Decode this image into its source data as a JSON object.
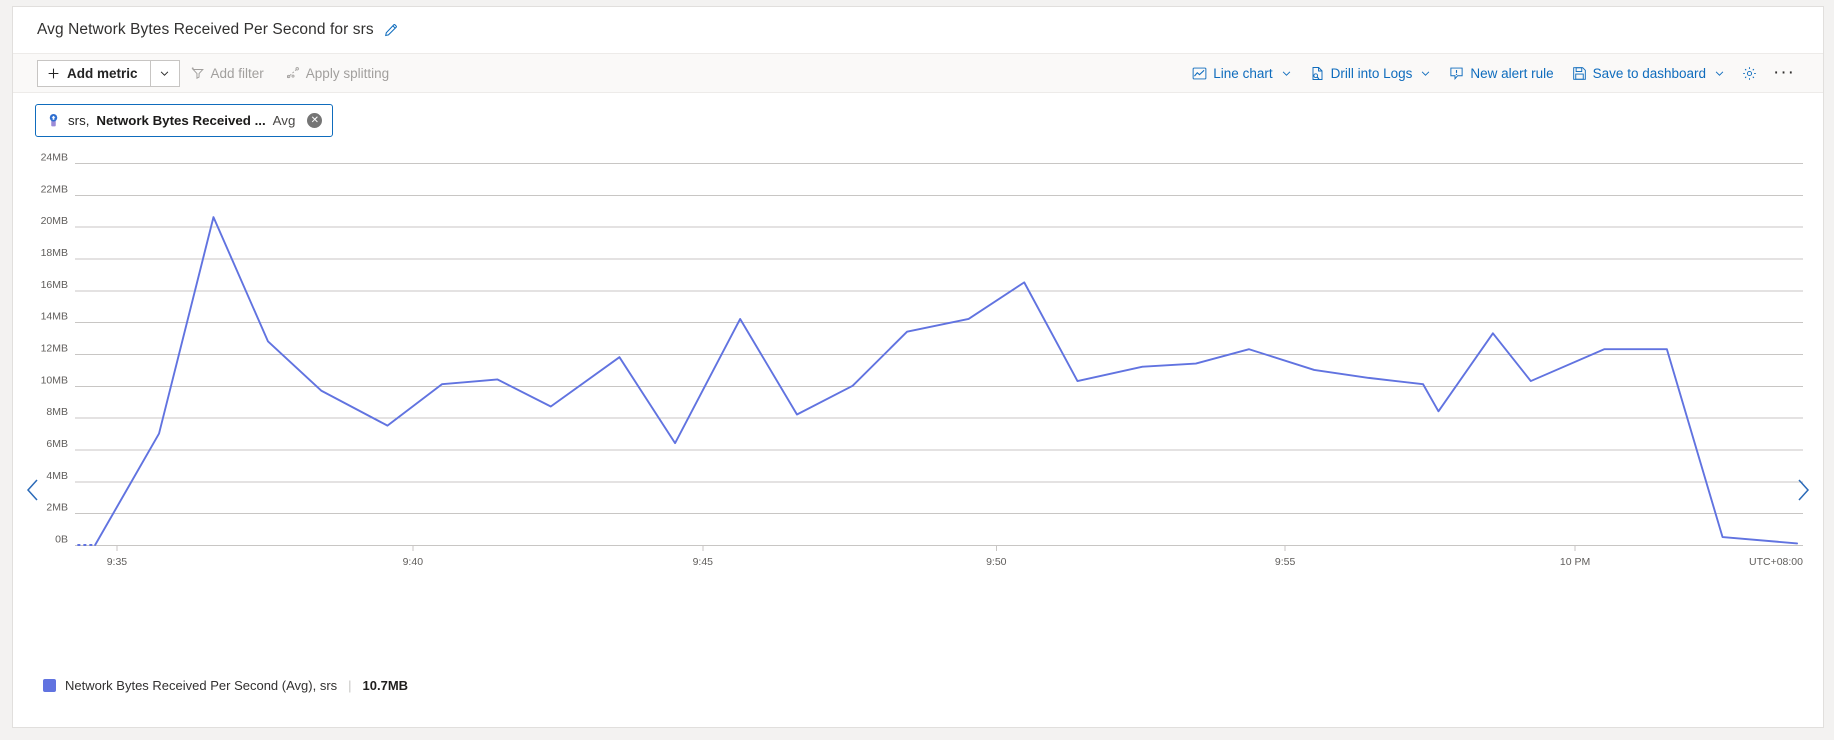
{
  "header": {
    "title": "Avg Network Bytes Received Per Second for srs",
    "edit_icon": "pencil-icon"
  },
  "toolbar": {
    "add_metric_label": "Add metric",
    "add_metric_caret": "chevron-down-icon",
    "add_filter_label": "Add filter",
    "apply_splitting_label": "Apply splitting",
    "line_chart_label": "Line chart",
    "drill_into_logs_label": "Drill into Logs",
    "new_alert_rule_label": "New alert rule",
    "save_to_dashboard_label": "Save to dashboard",
    "settings_icon": "gear-icon",
    "more_label": "···"
  },
  "metric_pill": {
    "resource": "srs,",
    "metric": "Network Bytes Received ...",
    "aggregation": "Avg",
    "close_icon": "close-circle-icon",
    "resource_icon": "azure-resource-icon"
  },
  "navigation": {
    "previous_icon": "chevron-left-icon",
    "next_icon": "chevron-right-icon"
  },
  "legend": {
    "swatch_color": "#6173e0",
    "label": "Network Bytes Received Per Second (Avg), srs",
    "value": "10.7MB"
  },
  "colors": {
    "accent": "#0f6cbd",
    "series": "#6173e0",
    "grid": "#c8c6c4",
    "text": "#323130"
  },
  "chart_data": {
    "type": "line",
    "title": "Avg Network Bytes Received Per Second for srs",
    "xlabel": "",
    "ylabel": "",
    "grid": true,
    "legend_position": "bottom-left",
    "timezone": "UTC+08:00",
    "yunit": "MB",
    "ylim": [
      0,
      25
    ],
    "ytick_labels": [
      "24MB",
      "22MB",
      "20MB",
      "18MB",
      "16MB",
      "14MB",
      "12MB",
      "10MB",
      "8MB",
      "6MB",
      "4MB",
      "2MB",
      "0B"
    ],
    "ytick_values": [
      24,
      22,
      20,
      18,
      16,
      14,
      12,
      10,
      8,
      6,
      4,
      2,
      0
    ],
    "xtick_labels": [
      "9:35",
      "9:40",
      "9:45",
      "9:50",
      "9:55",
      "10 PM"
    ],
    "xtick_positions": [
      95,
      345,
      590,
      838,
      1082,
      1327
    ],
    "series": [
      {
        "name": "Network Bytes Received Per Second (Avg), srs",
        "color": "#6173e0",
        "current_value": "10.7MB",
        "x": [
          62,
          77,
          131,
          177,
          223,
          268,
          292,
          324,
          370,
          417,
          462,
          497,
          520,
          567,
          591,
          622,
          670,
          717,
          763,
          790,
          815,
          838,
          862,
          907,
          930,
          962,
          1007,
          1052,
          1083,
          1107,
          1153,
          1199,
          1245,
          1258,
          1290,
          1327,
          1362,
          1405,
          1428,
          1452,
          1515
        ],
        "y": [
          0.0,
          0.0,
          7.0,
          20.6,
          12.8,
          9.7,
          7.5,
          10.1,
          10.4,
          8.7,
          11.8,
          6.4,
          14.2,
          8.2,
          10.0,
          13.4,
          14.2,
          16.5,
          10.3,
          11.2,
          11.4,
          11.9,
          12.3,
          11.0,
          10.5,
          10.1,
          8.4,
          13.3,
          10.3,
          12.3,
          12.3,
          0.5,
          0.2,
          0.2,
          0.1,
          0.1,
          0.1,
          0.1,
          0.1,
          0.1,
          0.1
        ]
      }
    ],
    "data_points": [
      {
        "x": 62,
        "value": 0.0
      },
      {
        "x": 77,
        "value": 0.0
      },
      {
        "x": 131,
        "value": 7.0
      },
      {
        "x": 177,
        "value": 20.6
      },
      {
        "x": 223,
        "value": 12.8
      },
      {
        "x": 268,
        "value": 9.7
      },
      {
        "x": 324,
        "value": 7.5
      },
      {
        "x": 370,
        "value": 10.1
      },
      {
        "x": 417,
        "value": 10.4
      },
      {
        "x": 462,
        "value": 8.7
      },
      {
        "x": 520,
        "value": 11.8
      },
      {
        "x": 567,
        "value": 6.4
      },
      {
        "x": 622,
        "value": 14.2
      },
      {
        "x": 670,
        "value": 8.2
      },
      {
        "x": 717,
        "value": 10.0
      },
      {
        "x": 763,
        "value": 13.4
      },
      {
        "x": 815,
        "value": 14.2
      },
      {
        "x": 862,
        "value": 16.5
      },
      {
        "x": 907,
        "value": 10.3
      },
      {
        "x": 962,
        "value": 11.2
      },
      {
        "x": 1007,
        "value": 11.4
      },
      {
        "x": 1052,
        "value": 12.3
      },
      {
        "x": 1107,
        "value": 11.0
      },
      {
        "x": 1153,
        "value": 10.5
      },
      {
        "x": 1199,
        "value": 10.1
      },
      {
        "x": 1212,
        "value": 8.4
      },
      {
        "x": 1258,
        "value": 13.3
      },
      {
        "x": 1290,
        "value": 10.3
      },
      {
        "x": 1352,
        "value": 12.3
      },
      {
        "x": 1405,
        "value": 12.3
      },
      {
        "x": 1452,
        "value": 0.5
      },
      {
        "x": 1515,
        "value": 0.1
      }
    ]
  }
}
